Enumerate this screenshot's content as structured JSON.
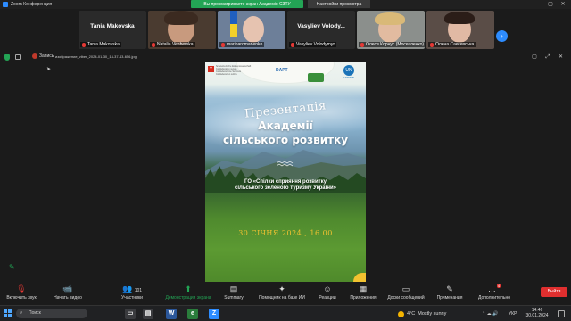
{
  "window": {
    "title": "Zoom Конференция",
    "share_banner": "Вы просматриваете экран Академія СЗТУ",
    "share_settings": "Настройки просмотра"
  },
  "participants": [
    {
      "big_name": "Tania Makovska",
      "label": "Tania Makovska",
      "video": false
    },
    {
      "label": "Natalia Venherska",
      "video": true
    },
    {
      "label": "marinaromanenko",
      "video": true
    },
    {
      "big_name": "Vasyliev Volody...",
      "label": "Vasyliev Volodymyr",
      "video": false
    },
    {
      "label": "Олеся Корнус (Москаленко)",
      "video": true
    },
    {
      "label": "Олена Саксевська",
      "video": true
    }
  ],
  "share_toolbar": {
    "speaker_label": "Запись",
    "file_name": "изображение_viber_2024-01-30_14-37-43-656.jpg"
  },
  "slide": {
    "swiss_text": "Schweizerische Eidgenossenschaft Confédération suisse Confederazione Svizzera Confederaziun svizra",
    "dapt_label": "DAPT",
    "un_label": "UN",
    "undp_label": "U N D P",
    "presentation_word": "Презентація",
    "title_line1": "Академії",
    "title_line2": "сільського розвитку",
    "org_line1": "ГО «Спілки сприяння розвитку",
    "org_line2": "сільського зеленого туризму України»",
    "date": "30 СІЧНЯ 2024 , 16.00"
  },
  "toolbar": {
    "items": [
      {
        "icon": "🎙",
        "label": "Включить звук"
      },
      {
        "icon": "📹",
        "label": "Начать видео"
      },
      {
        "icon": "👥",
        "label": "Участники",
        "count": "101"
      },
      {
        "icon": "⬆",
        "label": "Демонстрация экрана"
      },
      {
        "icon": "▤",
        "label": "Summary"
      },
      {
        "icon": "✦",
        "label": "Помощник на базе ИИ"
      },
      {
        "icon": "☺",
        "label": "Реакции"
      },
      {
        "icon": "▦",
        "label": "Приложения"
      },
      {
        "icon": "▭",
        "label": "Доски сообщений"
      },
      {
        "icon": "✎",
        "label": "Примечания"
      },
      {
        "icon": "…",
        "label": "Дополнительно",
        "badge": "4"
      }
    ],
    "leave_label": "Выйти"
  },
  "taskbar": {
    "search_placeholder": "Поиск",
    "weather_temp": "4°C",
    "weather_text": "Mostly sunny",
    "lang": "УКР",
    "time": "14:46",
    "date": "30.01.2024"
  },
  "colors": {
    "accent_green": "#23a455",
    "zoom_blue": "#2d8cff",
    "leave_red": "#e02f2f",
    "date_yellow": "#f2c230"
  }
}
